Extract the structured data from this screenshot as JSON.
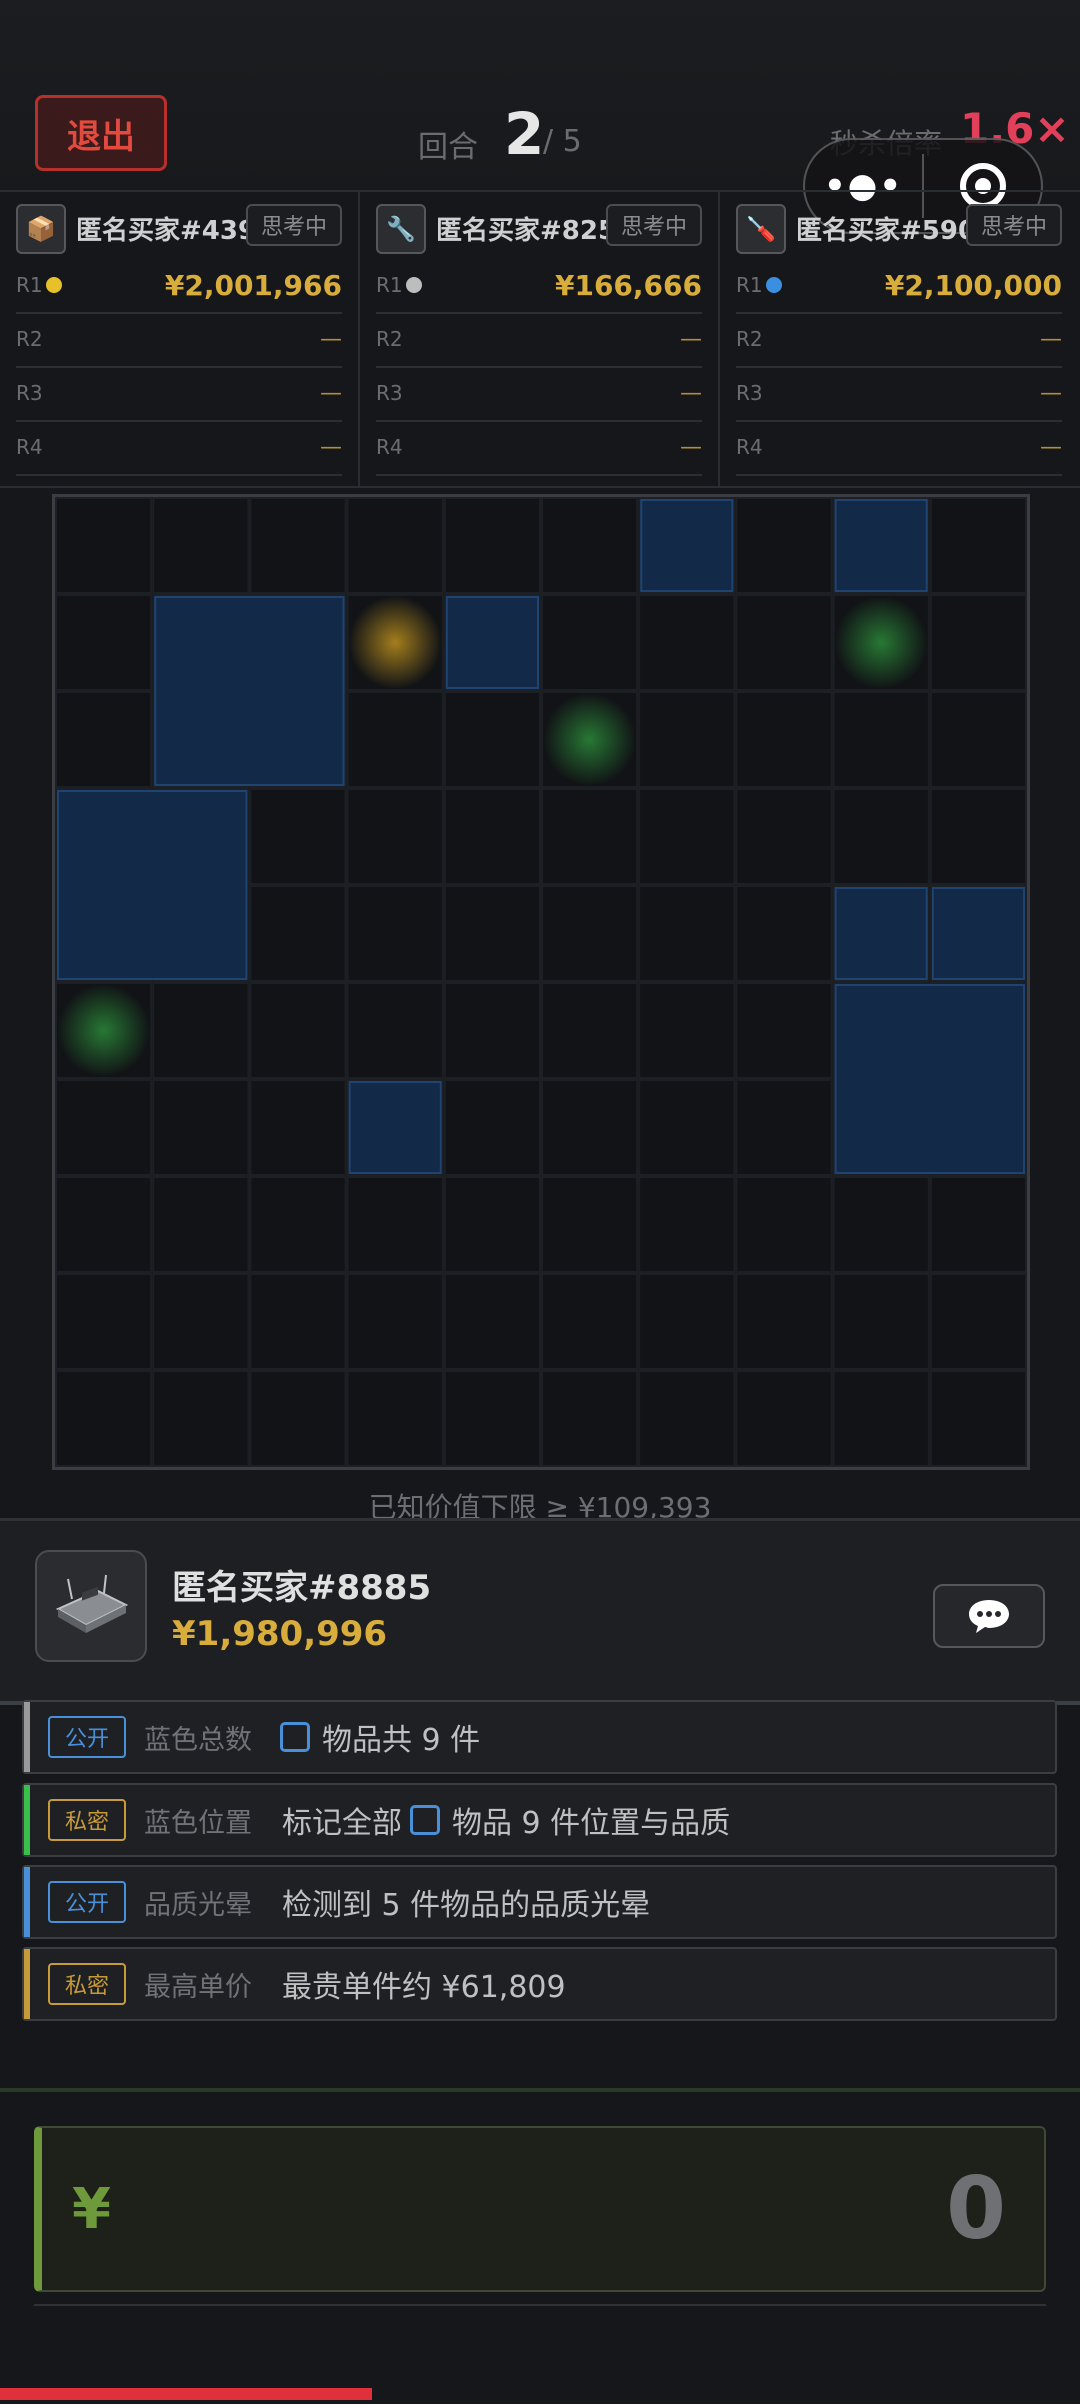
{
  "header": {
    "exit_label": "退出",
    "round_label": "回合",
    "round_current": "2",
    "round_total": "/ 5",
    "rate_label": "秒杀倍率",
    "rate_value": "1.6×"
  },
  "buyers": [
    {
      "name": "匿名买家#439",
      "status": "思考中",
      "icon": "📦",
      "rows": [
        {
          "r": "R1",
          "dot": "#e8c02a",
          "value": "¥2,001,966"
        },
        {
          "r": "R2",
          "value": "—"
        },
        {
          "r": "R3",
          "value": "—"
        },
        {
          "r": "R4",
          "value": "—"
        }
      ]
    },
    {
      "name": "匿名买家#825",
      "status": "思考中",
      "icon": "🔧",
      "rows": [
        {
          "r": "R1",
          "dot": "#bdbdbd",
          "value": "¥166,666"
        },
        {
          "r": "R2",
          "value": "—"
        },
        {
          "r": "R3",
          "value": "—"
        },
        {
          "r": "R4",
          "value": "—"
        }
      ]
    },
    {
      "name": "匿名买家#590",
      "status": "思考中",
      "icon": "🪛",
      "rows": [
        {
          "r": "R1",
          "dot": "#3a8fe0",
          "value": "¥2,100,000"
        },
        {
          "r": "R2",
          "value": "—"
        },
        {
          "r": "R3",
          "value": "—"
        },
        {
          "r": "R4",
          "value": "—"
        }
      ]
    }
  ],
  "grid": {
    "cols": 10,
    "rows": 10,
    "blue_items": [
      {
        "col": 6,
        "row": 0,
        "w": 1,
        "h": 1
      },
      {
        "col": 8,
        "row": 0,
        "w": 1,
        "h": 1
      },
      {
        "col": 1,
        "row": 1,
        "w": 2,
        "h": 2
      },
      {
        "col": 4,
        "row": 1,
        "w": 1,
        "h": 1
      },
      {
        "col": 0,
        "row": 3,
        "w": 2,
        "h": 2
      },
      {
        "col": 8,
        "row": 4,
        "w": 1,
        "h": 1
      },
      {
        "col": 9,
        "row": 4,
        "w": 1,
        "h": 1
      },
      {
        "col": 8,
        "row": 5,
        "w": 2,
        "h": 2
      },
      {
        "col": 3,
        "row": 6,
        "w": 1,
        "h": 1
      }
    ],
    "glows": [
      {
        "col": 3,
        "row": 1,
        "color": "#d4a21f"
      },
      {
        "col": 8,
        "row": 1,
        "color": "#2f9a3e"
      },
      {
        "col": 5,
        "row": 2,
        "color": "#2f9a3e"
      },
      {
        "col": 0,
        "row": 5,
        "color": "#2f9a3e"
      }
    ]
  },
  "lower_bound_text": "已知价值下限 ≥ ¥109,393",
  "player": {
    "name": "匿名买家#8885",
    "money": "¥1,980,996",
    "chat_icon": "speech-bubble-icon"
  },
  "info": [
    {
      "tag": "公开",
      "tag_type": "pub",
      "bar": "#9a9a9a",
      "key": "蓝色总数",
      "pre": "",
      "square": true,
      "text": "物品共 9 件"
    },
    {
      "tag": "私密",
      "tag_type": "pri",
      "bar": "#3bbf4a",
      "key": "蓝色位置",
      "pre": "标记全部",
      "square": true,
      "text": "物品 9 件位置与品质"
    },
    {
      "tag": "公开",
      "tag_type": "pub",
      "bar": "#4a90d9",
      "key": "品质光晕",
      "pre": "",
      "square": false,
      "text": "检测到 5 件物品的品质光晕"
    },
    {
      "tag": "私密",
      "tag_type": "pri",
      "bar": "#c79a3a",
      "key": "最高单价",
      "pre": "",
      "square": false,
      "text": "最贵单件约 ¥61,809"
    }
  ],
  "bid": {
    "currency": "¥",
    "value": "0"
  }
}
